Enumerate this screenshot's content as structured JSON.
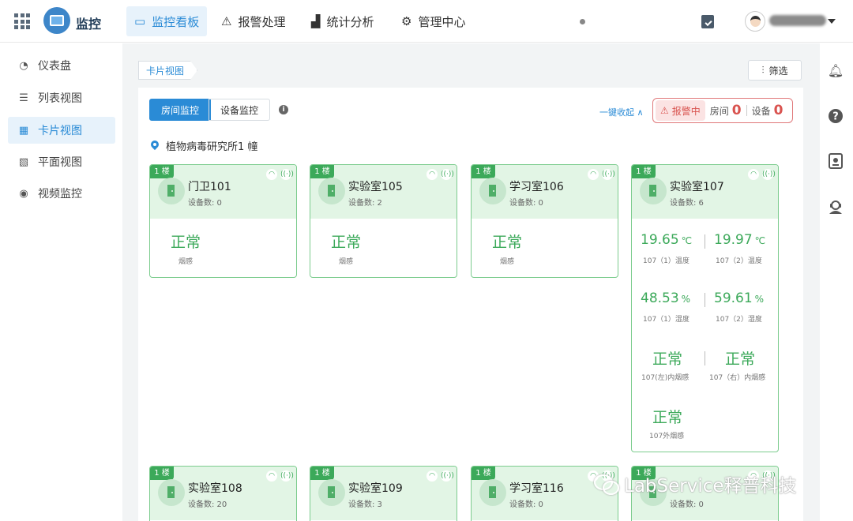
{
  "header": {
    "brand": "监控",
    "nav": [
      {
        "label": "监控看板",
        "icon": "dashboard-icon"
      },
      {
        "label": "报警处理",
        "icon": "alarm-icon"
      },
      {
        "label": "统计分析",
        "icon": "bar-chart-icon"
      },
      {
        "label": "管理中心",
        "icon": "gear-icon"
      }
    ]
  },
  "sidebar": {
    "items": [
      {
        "label": "仪表盘",
        "icon": "gauge-icon"
      },
      {
        "label": "列表视图",
        "icon": "list-icon"
      },
      {
        "label": "卡片视图",
        "icon": "card-grid-icon"
      },
      {
        "label": "平面视图",
        "icon": "floorplan-icon"
      },
      {
        "label": "视频监控",
        "icon": "camera-icon"
      }
    ]
  },
  "main": {
    "breadcrumb": "卡片视图",
    "filter_label": "筛选",
    "tabs": [
      "房间监控",
      "设备监控"
    ],
    "collapse_all": "一键收起",
    "alarm": {
      "tag": "报警中",
      "room_label": "房间",
      "room_count": "0",
      "device_label": "设备",
      "device_count": "0"
    },
    "building": "植物病毒研究所1 幢"
  },
  "cards": [
    {
      "floor": "1 楼",
      "name": "门卫101",
      "devices": "设备数: 0",
      "status": "正常",
      "sensor": "烟感"
    },
    {
      "floor": "1 楼",
      "name": "实验室105",
      "devices": "设备数: 2",
      "status": "正常",
      "sensor": "烟感"
    },
    {
      "floor": "1 楼",
      "name": "学习室106",
      "devices": "设备数: 0",
      "status": "正常",
      "sensor": "烟感"
    },
    {
      "floor": "1 楼",
      "name": "实验室107",
      "devices": "设备数: 6",
      "temp": [
        {
          "value": "19.65",
          "unit": "℃",
          "label": "107（1）温度"
        },
        {
          "value": "19.97",
          "unit": "℃",
          "label": "107（2）温度"
        }
      ],
      "humid": [
        {
          "value": "48.53",
          "unit": "%",
          "label": "107（1）湿度"
        },
        {
          "value": "59.61",
          "unit": "%",
          "label": "107（2）湿度"
        }
      ],
      "smoke": [
        {
          "status": "正常",
          "label": "107(左)内烟感"
        },
        {
          "status": "正常",
          "label": "107（右）内烟感"
        },
        {
          "status": "正常",
          "label": "107外烟感"
        }
      ]
    },
    {
      "floor": "1 楼",
      "name": "实验室108",
      "devices": "设备数: 20"
    },
    {
      "floor": "1 楼",
      "name": "实验室109",
      "devices": "设备数: 3"
    },
    {
      "floor": "1 楼",
      "name": "学习室116",
      "devices": "设备数: 0"
    },
    {
      "floor": "1 楼",
      "name": "",
      "devices": "设备数: 0"
    }
  ],
  "watermark": "LabService释普科技"
}
